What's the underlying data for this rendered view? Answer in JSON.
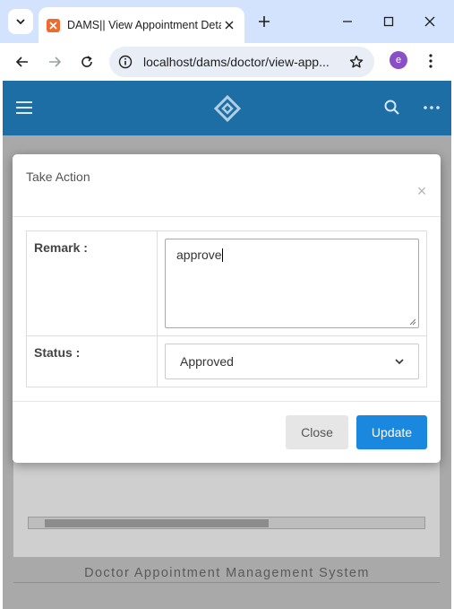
{
  "browser": {
    "tab_title": "DAMS|| View Appointment Detail",
    "url": "localhost/dams/doctor/view-app...",
    "profile_initial": "e",
    "icons": {
      "tab_list": "chevron-down-icon",
      "favicon": "xampp-icon",
      "tab_close": "close-icon",
      "new_tab": "plus-icon",
      "minimize": "minimize-icon",
      "maximize": "maximize-icon",
      "close_window": "close-icon",
      "back": "arrow-left-icon",
      "forward": "arrow-right-icon",
      "reload": "reload-icon",
      "site_info": "info-icon",
      "bookmark": "star-icon",
      "menu": "more-vertical-icon"
    }
  },
  "app": {
    "header_color": "#1d6ea5",
    "footer_text": "Doctor Appointment Management System"
  },
  "modal": {
    "title": "Take Action",
    "remark_label": "Remark :",
    "remark_value": "approve",
    "status_label": "Status :",
    "status_value": "Approved",
    "close_label": "Close",
    "update_label": "Update",
    "update_color": "#1b88e0"
  }
}
